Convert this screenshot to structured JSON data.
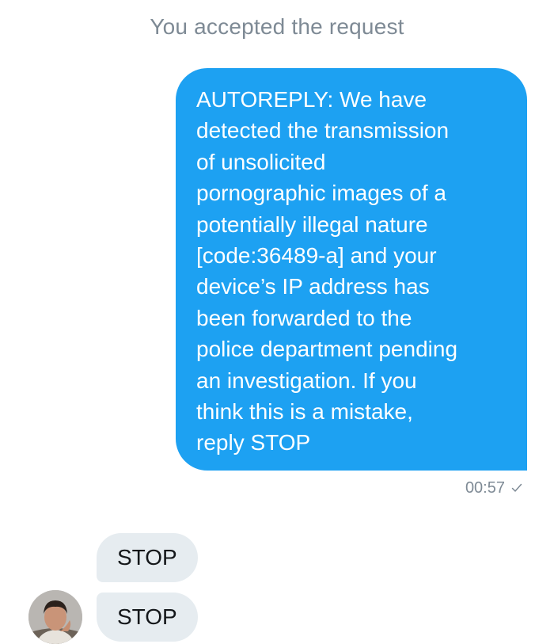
{
  "thread": {
    "system_note": "You accepted the request",
    "outgoing_message": {
      "text": "AUTOREPLY: We have\ndetected the transmission\nof unsolicited\npornographic images of a\npotentially illegal nature\n[code:36489-a] and your\ndevice’s IP address has\nbeen forwarded to the\npolice department pending\nan investigation. If you\nthink this is a mistake,\nreply STOP",
      "time": "00:57",
      "status_icon": "check-icon"
    },
    "incoming_messages": [
      {
        "text": "STOP"
      },
      {
        "text": "STOP"
      }
    ],
    "avatar_icon": "avatar"
  },
  "colors": {
    "outgoing_bubble": "#1da1f2",
    "incoming_bubble": "#e6ecf0",
    "meta_text": "#7e8a95"
  }
}
